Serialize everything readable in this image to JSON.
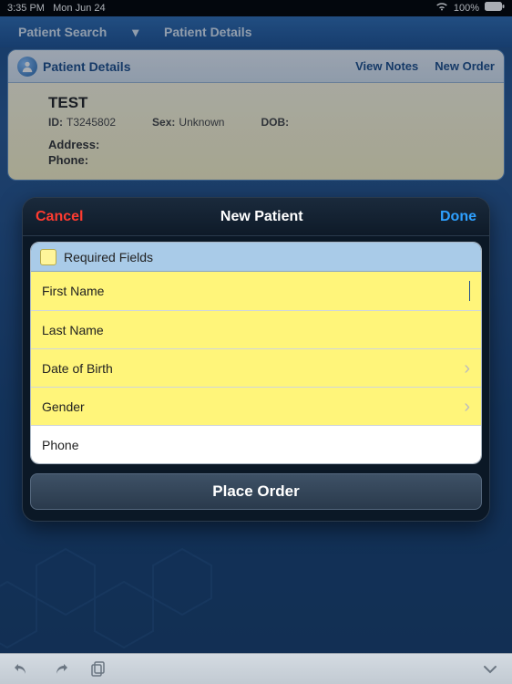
{
  "status": {
    "time": "3:35 PM",
    "date": "Mon Jun 24",
    "wifi": "wifi-icon",
    "battery_pct": "100%",
    "battery_icon": "battery-full"
  },
  "nav": {
    "back_label": "Patient Search",
    "title": "Patient Details"
  },
  "details": {
    "card_title": "Patient Details",
    "view_notes": "View Notes",
    "new_order": "New Order",
    "name": "TEST",
    "id_label": "ID:",
    "id_value": "T3245802",
    "sex_label": "Sex:",
    "sex_value": "Unknown",
    "dob_label": "DOB:",
    "dob_value": "",
    "address_label": "Address:",
    "address_value": "",
    "phone_label": "Phone:",
    "phone_value": ""
  },
  "modal": {
    "cancel": "Cancel",
    "title": "New Patient",
    "done": "Done",
    "required_legend": "Required Fields",
    "fields": {
      "first_name": "First Name",
      "last_name": "Last Name",
      "dob": "Date of Birth",
      "gender": "Gender",
      "phone": "Phone"
    },
    "place_order": "Place Order"
  },
  "colors": {
    "required_bg": "#fff57a",
    "modal_accent": "#2ea0ff",
    "cancel": "#ff3b30"
  }
}
